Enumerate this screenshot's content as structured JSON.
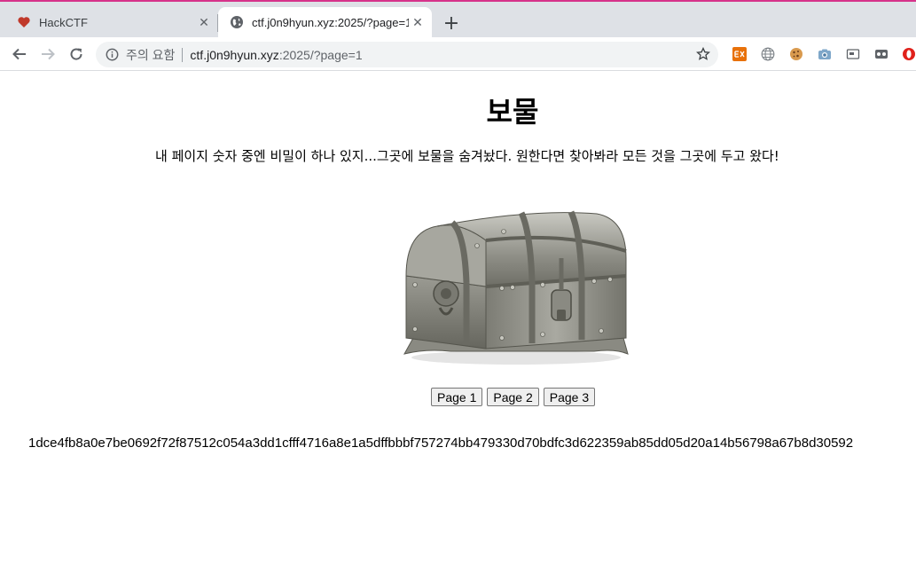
{
  "browser": {
    "tabs": [
      {
        "title": "HackCTF",
        "favicon": "heart-icon"
      },
      {
        "title": "ctf.j0n9hyun.xyz:2025/?page=1",
        "favicon": "globe-icon"
      }
    ],
    "close_glyph": "✕",
    "newtab_glyph": "+",
    "address": {
      "security_label": "주의 요함",
      "host": "ctf.j0n9hyun.xyz",
      "path": ":2025/?page=1"
    },
    "extensions": [
      "ex-icon",
      "globe-extension-icon",
      "cookie-icon",
      "camera-icon",
      "screen-icon",
      "mask-icon",
      "opera-icon"
    ],
    "colors": {
      "accent": "#d6338a",
      "tabstrip": "#dee1e6",
      "omnibox": "#f1f3f4"
    }
  },
  "page": {
    "title": "보물",
    "description": "내 페이지 숫자 중엔 비밀이 하나 있지...그곳에 보물을 숨겨놨다. 원한다면 찾아봐라 모든 것을 그곳에 두고 왔다!",
    "image": "treasure-chest",
    "pager": [
      {
        "label": "Page 1"
      },
      {
        "label": "Page 2"
      },
      {
        "label": "Page 3"
      }
    ],
    "hash": "1dce4fb8a0e7be0692f72f87512c054a3dd1cfff4716a8e1a5dffbbbf757274bb479330d70bdfc3d622359ab85dd05d20a14b56798a67b8d30592"
  }
}
